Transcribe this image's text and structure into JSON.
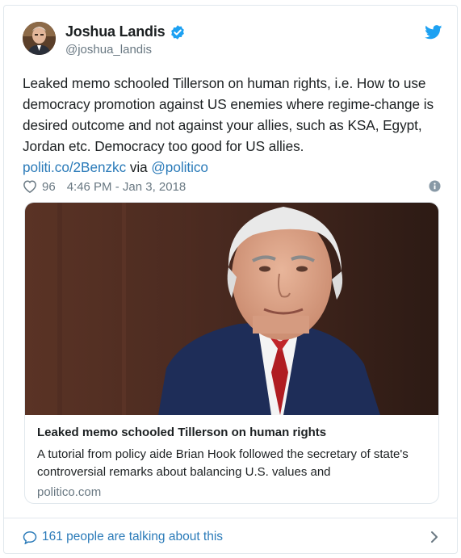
{
  "author": {
    "display_name": "Joshua Landis",
    "handle": "@joshua_landis",
    "verified": true
  },
  "tweet": {
    "text_plain": "Leaked memo schooled Tillerson on human rights, i.e. How to use democracy promotion against US enemies where regime-change is desired outcome and not against your allies, such as KSA, Egypt, Jordan etc. Democracy too good for US allies.",
    "link_text": "politi.co/2Benzkc",
    "via_text": " via ",
    "mention": "@politico"
  },
  "meta": {
    "likes": "96",
    "timestamp": "4:46 PM - Jan 3, 2018"
  },
  "link_card": {
    "title": "Leaked memo schooled Tillerson on human rights",
    "description": "A tutorial from policy aide Brian Hook followed the secretary of state's controversial remarks about balancing U.S. values and",
    "domain": "politico.com"
  },
  "footer": {
    "talking_label": "161 people are talking about this"
  },
  "icons": {
    "verified": "verified-badge-icon",
    "brand": "twitter-bird-icon",
    "like": "heart-icon",
    "info": "info-icon",
    "reply": "speech-bubble-icon",
    "expand": "chevron-right-icon"
  },
  "colors": {
    "link_blue": "#2b7bb9",
    "verified_blue": "#1da1f2",
    "muted_gray": "#697882",
    "border": "#e1e8ed"
  }
}
